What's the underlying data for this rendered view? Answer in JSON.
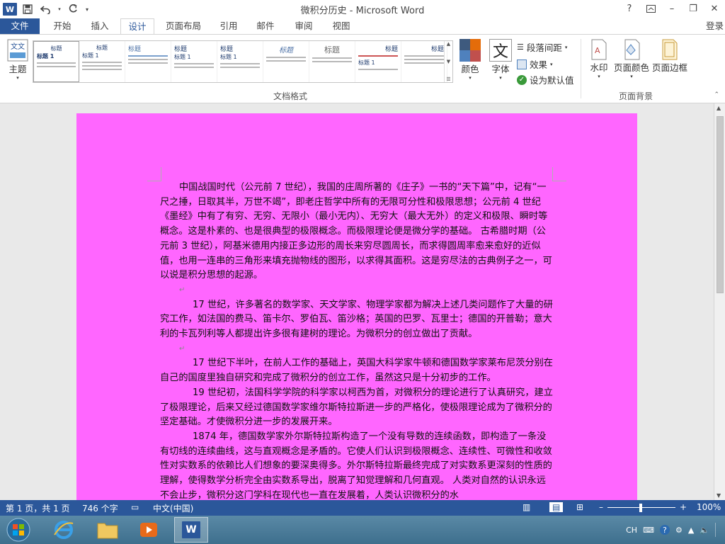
{
  "window": {
    "title": "微积分历史 - Microsoft Word",
    "help": "?",
    "restore_label": "□",
    "minimize": "–",
    "maximize": "❐",
    "close": "✕"
  },
  "qat": {
    "app_icon": "W",
    "save_icon": "save-icon",
    "undo_icon": "undo-icon",
    "redo_icon": "redo-icon",
    "more_icon": "customize-icon"
  },
  "tabs": [
    "文件",
    "开始",
    "插入",
    "设计",
    "页面布局",
    "引用",
    "邮件",
    "审阅",
    "视图"
  ],
  "active_tab": "设计",
  "login": "登录",
  "ribbon": {
    "theme_label": "主题",
    "gallery_heading": "标题",
    "gallery_heading1": "标题 1",
    "group_doc_format": "文档格式",
    "colors_label": "颜色",
    "fonts_label": "字体",
    "font_glyph": "文",
    "para_spacing": "段落间距",
    "effects": "效果",
    "set_default": "设为默认值",
    "watermark": "水印",
    "page_color": "页面颜色",
    "page_border": "页面边框",
    "group_page_bg": "页面背景"
  },
  "document": {
    "paragraphs": [
      "中国战国时代（公元前 7 世纪），我国的庄周所著的《庄子》一书的“天下篇”中，记有“一尺之捶，日取其半，万世不竭”，即老庄哲学中所有的无限可分性和极限思想；公元前 4 世纪《墨经》中有了有穷、无穷、无限小（最小无内）、无穷大（最大无外）的定义和极限、瞬时等概念。这是朴素的、也是很典型的极限概念。而极限理论便是微分学的基础。    古希腊时期（公元前 3 世纪），阿基米德用内接正多边形的周长来穷尽圆周长，而求得圆周率愈来愈好的近似值，也用一连串的三角形来填充抛物线的图形，以求得其面积。这是穷尽法的古典例子之一，可以说是积分思想的起源。",
      "17 世纪，许多著名的数学家、天文学家、物理学家都为解决上述几类问题作了大量的研究工作，如法国的费马、笛卡尔、罗伯瓦、笛沙格；英国的巴罗、瓦里士；德国的开普勒；意大利的卡瓦列利等人都提出许多很有建树的理论。为微积分的创立做出了贡献。",
      "17 世纪下半叶，在前人工作的基础上，英国大科学家牛顿和德国数学家莱布尼茨分别在自己的国度里独自研究和完成了微积分的创立工作，虽然这只是十分初步的工作。",
      "19 世纪初，法国科学学院的科学家以柯西为首，对微积分的理论进行了认真研究，建立了极限理论，后来又经过德国数学家维尔斯特拉斯进一步的严格化，使极限理论成为了微积分的坚定基础。才使微积分进一步的发展开来。",
      "1874 年，德国数学家外尔斯特拉斯构造了一个没有导数的连续函数，即构造了一条没有切线的连续曲线，这与直观概念是矛盾的。它使人们认识到极限概念、连续性、可微性和收敛性对实数系的依赖比人们想象的要深奥得多。外尔斯特拉斯最终完成了对实数系更深刻的性质的理解，使得数学分析完全由实数系导出，脱离了知觉理解和几何直观。    人类对自然的认识永远不会止步，微积分这门学科在现代也一直在发展着，人类认识微积分的水"
    ],
    "para_mark": "↵"
  },
  "status": {
    "page": "第 1 页，共 1 页",
    "words": "746 个字",
    "lang": "中文(中国)",
    "zoom": "100%",
    "zoom_minus": "–",
    "zoom_plus": "+"
  },
  "taskbar": {
    "ime": "CH",
    "help_icon": "?"
  },
  "colors": {
    "accent": "#2b579a",
    "page_bg": "#ff66ff"
  }
}
